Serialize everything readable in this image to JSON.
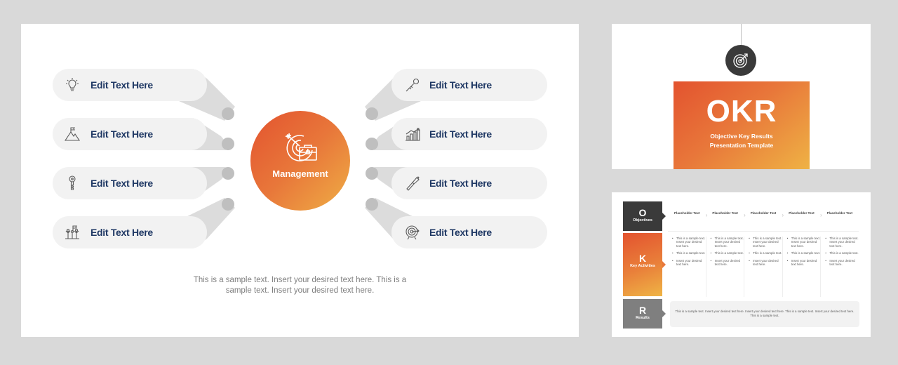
{
  "main_slide": {
    "center": {
      "label": "Management",
      "icon": "target-briefcase-icon"
    },
    "left_items": [
      {
        "label": "Edit Text Here",
        "icon": "lightbulb-icon"
      },
      {
        "label": "Edit Text Here",
        "icon": "mountain-flag-icon"
      },
      {
        "label": "Edit Text Here",
        "icon": "key-icon"
      },
      {
        "label": "Edit Text Here",
        "icon": "team-flag-icon"
      }
    ],
    "right_items": [
      {
        "label": "Edit Text Here",
        "icon": "dart-icon"
      },
      {
        "label": "Edit Text Here",
        "icon": "growth-chart-icon"
      },
      {
        "label": "Edit Text Here",
        "icon": "telescope-icon"
      },
      {
        "label": "Edit Text Here",
        "icon": "target-icon"
      }
    ],
    "footer_text": "This is a sample text. Insert your desired text here. This is a sample text. Insert your desired text here."
  },
  "title_slide": {
    "badge_icon": "target-arrow-icon",
    "title": "OKR",
    "subtitle_line1": "Objective Key Results",
    "subtitle_line2": "Presentation Template"
  },
  "okr_slide": {
    "blocks": [
      {
        "letter": "O",
        "name": "Objectives"
      },
      {
        "letter": "K",
        "name": "Key Activities"
      },
      {
        "letter": "R",
        "name": "Results"
      }
    ],
    "placeholders": [
      "Placeholder Text",
      "Placeholder Text",
      "Placeholder Text",
      "Placeholder Text",
      "Placeholder Text"
    ],
    "bullets": [
      "This is a sample text. Insert your desired text here.",
      "This is a sample text.",
      "Insert your desired text here."
    ],
    "results_text": "This is a sample text. Insert your desired text here. Insert your desired text here. This is a sample text. Insert your desired text here. This is a sample text."
  },
  "colors": {
    "background": "#d9d9d9",
    "pill": "#f2f2f2",
    "pill_text": "#1f3864",
    "connector": "#d9d9d9",
    "connector_dot": "#bfbfbf",
    "gradient_start": "#e3532f",
    "gradient_end": "#efb445",
    "dark_block": "#3a3a3a",
    "gray_block": "#7f7f7f"
  }
}
